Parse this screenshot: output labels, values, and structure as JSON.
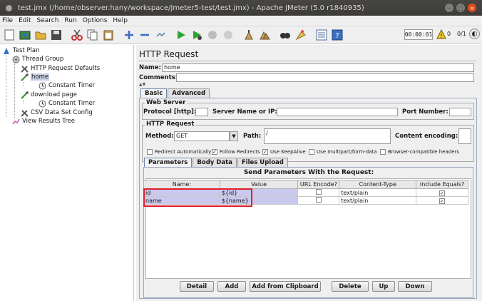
{
  "window": {
    "title": "test.jmx (/home/observer.hany/workspace/Jmeter5-test/test.jmx) - Apache JMeter (5.0 r1840935)"
  },
  "menubar": [
    {
      "label": "File"
    },
    {
      "label": "Edit"
    },
    {
      "label": "Search"
    },
    {
      "label": "Run"
    },
    {
      "label": "Options"
    },
    {
      "label": "Help"
    }
  ],
  "status": {
    "elapsed": "00:00:01",
    "warnings": "0",
    "threads": "0/1"
  },
  "tree": {
    "test_plan": "Test Plan",
    "thread_group": "Thread Group",
    "http_defaults": "HTTP Request Defaults",
    "home": "home",
    "home_timer": "Constant Timer",
    "download_page": "download page",
    "download_timer": "Constant Timer",
    "csv_config": "CSV Data Set Config",
    "results_tree": "View Results Tree"
  },
  "sampler": {
    "title": "HTTP Request",
    "name_label": "Name:",
    "name_value": "home",
    "comments_label": "Comments:",
    "comments_value": "",
    "tabs": {
      "basic": "Basic",
      "advanced": "Advanced"
    },
    "web_server": {
      "title": "Web Server",
      "protocol_label": "Protocol [http]:",
      "protocol_value": "",
      "server_label": "Server Name or IP:",
      "server_value": "",
      "port_label": "Port Number:",
      "port_value": ""
    },
    "http_request": {
      "title": "HTTP Request",
      "method_label": "Method:",
      "method_value": "GET",
      "path_label": "Path:",
      "path_value": "/",
      "encoding_label": "Content encoding:",
      "encoding_value": ""
    },
    "options": {
      "redirect_auto": {
        "label": "Redirect Automatically",
        "checked": false
      },
      "follow_redirects": {
        "label": "Follow Redirects",
        "checked": true
      },
      "keepalive": {
        "label": "Use KeepAlive",
        "checked": true
      },
      "multipart": {
        "label": "Use multipart/form-data",
        "checked": false
      },
      "browser_headers": {
        "label": "Browser-compatible headers",
        "checked": false
      }
    },
    "subtabs": {
      "parameters": "Parameters",
      "body": "Body Data",
      "files": "Files Upload"
    },
    "params_heading": "Send Parameters With the Request:",
    "columns": [
      "Name:",
      "Value",
      "URL Encode?",
      "Content-Type",
      "Include Equals?"
    ],
    "rows": [
      {
        "name": "id",
        "value": "${id}",
        "content_type": "text/plain"
      },
      {
        "name": "name",
        "value": "${name}",
        "content_type": "text/plain"
      }
    ],
    "buttons": {
      "detail": "Detail",
      "add": "Add",
      "add_clipboard": "Add from Clipboard",
      "delete": "Delete",
      "up": "Up",
      "down": "Down"
    }
  },
  "colors": {
    "selection": "#c9c9ee",
    "highlight_box": "#e01e2a",
    "close_button": "#df4a16"
  }
}
